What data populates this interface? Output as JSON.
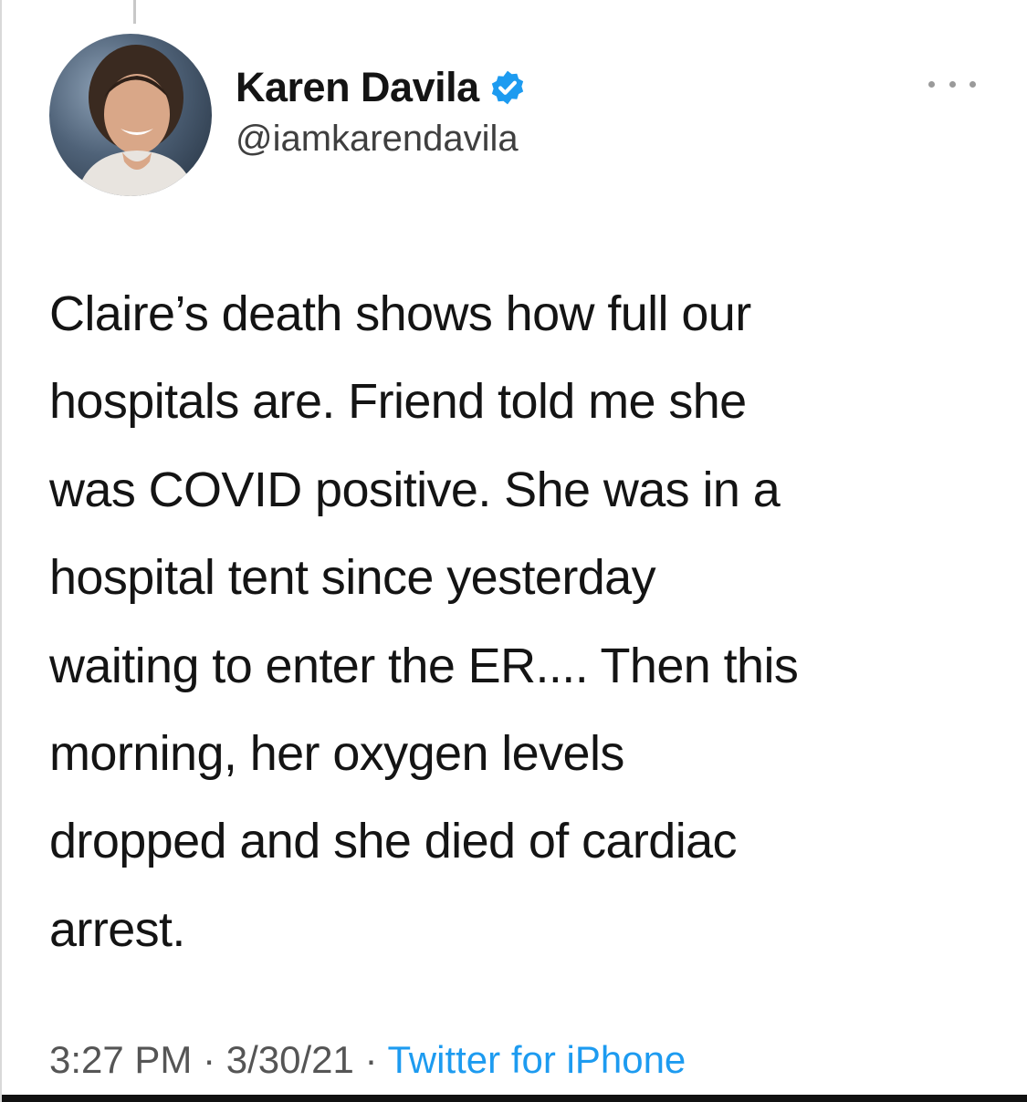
{
  "author": {
    "display_name": "Karen Davila",
    "handle": "@iamkarendavila",
    "verified": true,
    "avatar_icon": "profile-photo"
  },
  "tweet": {
    "text": "Claire’s death shows how full our\nhospitals are. Friend told me she\nwas COVID positive. She was in a\nhospital tent since yesterday\nwaiting to enter the ER.... Then this\nmorning, her oxygen levels\ndropped and she died of cardiac\narrest."
  },
  "meta": {
    "time": "3:27 PM",
    "separator": " · ",
    "date": "3/30/21",
    "source": "Twitter for iPhone"
  },
  "icons": {
    "more": "more-icon",
    "verified": "verified-badge-icon"
  },
  "colors": {
    "accent": "#1d9bf0",
    "text": "#141414",
    "secondary": "#555555"
  }
}
